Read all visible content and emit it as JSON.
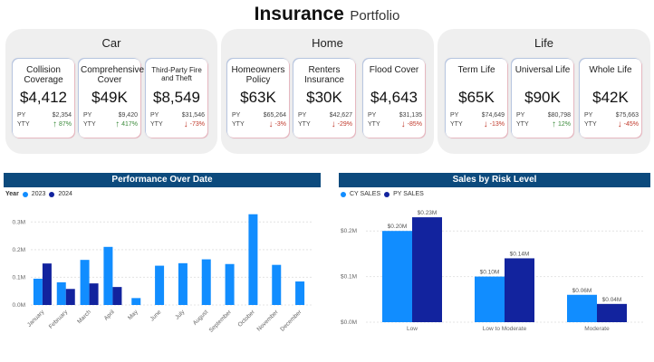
{
  "header": {
    "title_main": "Insurance",
    "title_sub": "Portfolio"
  },
  "groups": [
    {
      "title": "Car",
      "cards": [
        {
          "label": "Collision Coverage",
          "value": "$4,412",
          "py_label": "PY",
          "py": "$2,354",
          "yty_label": "YTY",
          "yty": "87%",
          "dir": "up"
        },
        {
          "label": "Comprehensive Cover",
          "value": "$49K",
          "py_label": "PY",
          "py": "$9,420",
          "yty_label": "YTY",
          "yty": "417%",
          "dir": "up"
        },
        {
          "label": "Third-Party Fire and Theft",
          "value": "$8,549",
          "py_label": "PY",
          "py": "$31,546",
          "yty_label": "YTY",
          "yty": "-73%",
          "dir": "down",
          "small": true
        }
      ]
    },
    {
      "title": "Home",
      "cards": [
        {
          "label": "Homeowners Policy",
          "value": "$63K",
          "py_label": "PY",
          "py": "$65,264",
          "yty_label": "YTY",
          "yty": "-3%",
          "dir": "down"
        },
        {
          "label": "Renters Insurance",
          "value": "$30K",
          "py_label": "PY",
          "py": "$42,627",
          "yty_label": "YTY",
          "yty": "-29%",
          "dir": "down"
        },
        {
          "label": "Flood Cover",
          "value": "$4,643",
          "py_label": "PY",
          "py": "$31,135",
          "yty_label": "YTY",
          "yty": "-85%",
          "dir": "down"
        }
      ]
    },
    {
      "title": "Life",
      "cards": [
        {
          "label": "Term Life",
          "value": "$65K",
          "py_label": "PY",
          "py": "$74,649",
          "yty_label": "YTY",
          "yty": "-13%",
          "dir": "down"
        },
        {
          "label": "Universal Life",
          "value": "$90K",
          "py_label": "PY",
          "py": "$80,798",
          "yty_label": "YTY",
          "yty": "12%",
          "dir": "up"
        },
        {
          "label": "Whole Life",
          "value": "$42K",
          "py_label": "PY",
          "py": "$75,663",
          "yty_label": "YTY",
          "yty": "-45%",
          "dir": "down"
        }
      ]
    }
  ],
  "colors": {
    "series_a": "#118dff",
    "series_b": "#12239e",
    "header_bg": "#0c4a7d",
    "up": "#3a8a3a",
    "down": "#c0392b"
  },
  "perf_panel": {
    "title": "Performance Over Date",
    "legend_title": "Year",
    "legend": [
      "2023",
      "2024"
    ]
  },
  "risk_panel": {
    "title": "Sales by Risk Level",
    "legend": [
      "CY SALES",
      "PY SALES"
    ]
  },
  "chart_data": [
    {
      "type": "bar",
      "title": "Performance Over Date",
      "categories": [
        "January",
        "February",
        "March",
        "April",
        "May",
        "June",
        "July",
        "August",
        "September",
        "October",
        "November",
        "December"
      ],
      "series": [
        {
          "name": "2023",
          "values": [
            0.095,
            0.082,
            0.163,
            0.21,
            0.025,
            0.142,
            0.151,
            0.165,
            0.148,
            0.328,
            0.145,
            0.085
          ]
        },
        {
          "name": "2024",
          "values": [
            0.15,
            0.058,
            0.078,
            0.065,
            null,
            null,
            null,
            null,
            null,
            null,
            null,
            null
          ]
        }
      ],
      "ylim": [
        0,
        0.35
      ],
      "yticks": [
        0,
        0.1,
        0.2,
        0.3
      ],
      "ytick_labels": [
        "0.0M",
        "0.1M",
        "0.2M",
        "0.3M"
      ],
      "legend_position": "top-left",
      "grid": true
    },
    {
      "type": "bar",
      "title": "Sales by Risk Level",
      "categories": [
        "Low",
        "Low to Moderate",
        "Moderate"
      ],
      "series": [
        {
          "name": "CY SALES",
          "values": [
            0.2,
            0.1,
            0.06
          ],
          "labels": [
            "$0.20M",
            "$0.10M",
            "$0.06M"
          ]
        },
        {
          "name": "PY SALES",
          "values": [
            0.23,
            0.14,
            0.04
          ],
          "labels": [
            "$0.23M",
            "$0.14M",
            "$0.04M"
          ]
        }
      ],
      "ylim": [
        0,
        0.25
      ],
      "yticks": [
        0,
        0.1,
        0.2
      ],
      "ytick_labels": [
        "$0.0M",
        "$0.1M",
        "$0.2M"
      ],
      "legend_position": "top-left",
      "grid": true
    }
  ]
}
